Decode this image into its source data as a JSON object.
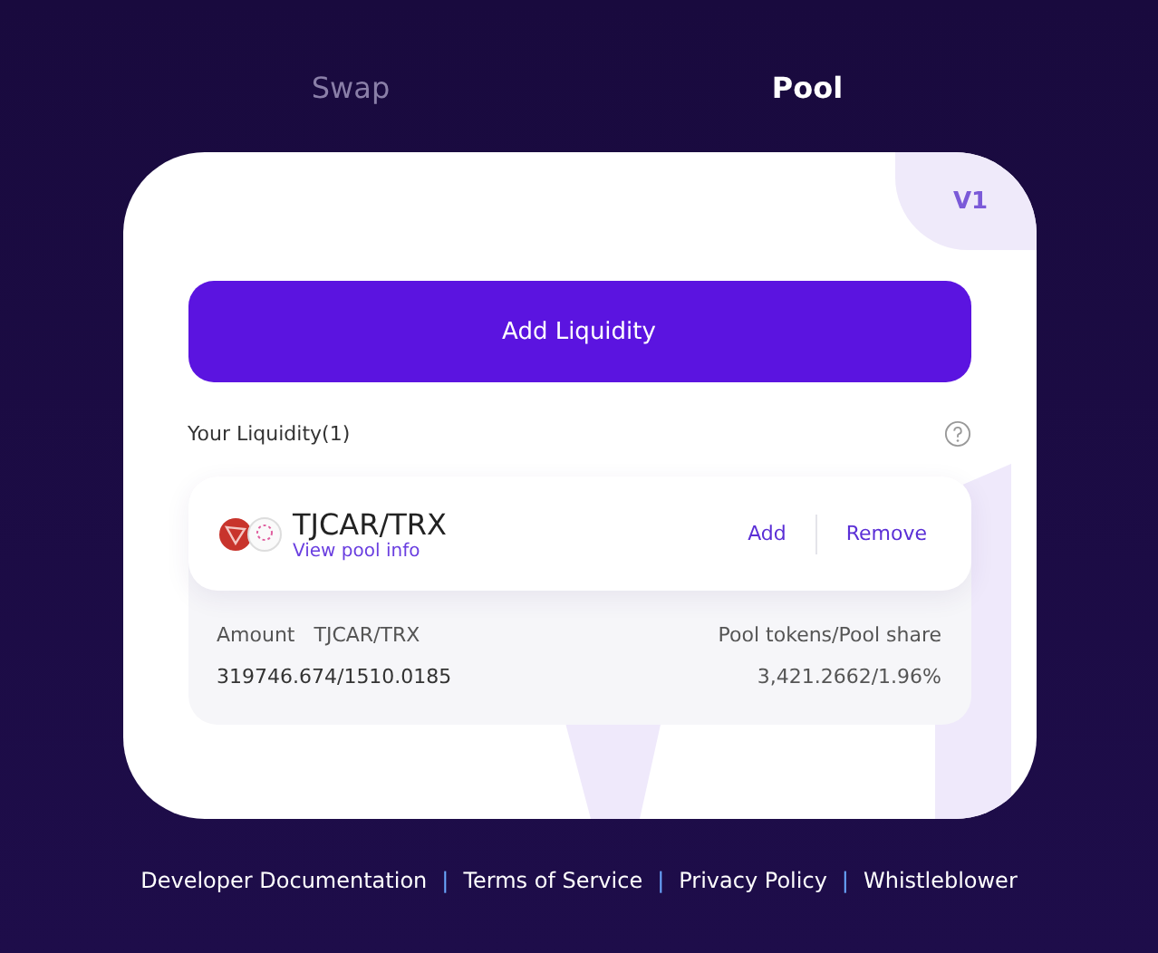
{
  "tabs": [
    {
      "label": "Swap",
      "selected": false
    },
    {
      "label": "Pool",
      "selected": true
    }
  ],
  "version_badge": "V1",
  "add_liquidity_button": "Add Liquidity",
  "liquidity_heading": "Your Liquidity(1)",
  "pools": [
    {
      "pair": "TJCAR/TRX",
      "info_link": "View pool info",
      "actions": [
        "Add",
        "Remove"
      ],
      "amount_label": "Amount",
      "amount_pair": "TJCAR/TRX",
      "amount_value": "319746.674/1510.0185",
      "share_label": "Pool tokens/Pool share",
      "share_value": "3,421.2662/1.96%"
    }
  ],
  "footer": {
    "links": [
      "Developer Documentation",
      "Terms of Service",
      "Privacy Policy",
      "Whistleblower"
    ],
    "separator": "|"
  }
}
